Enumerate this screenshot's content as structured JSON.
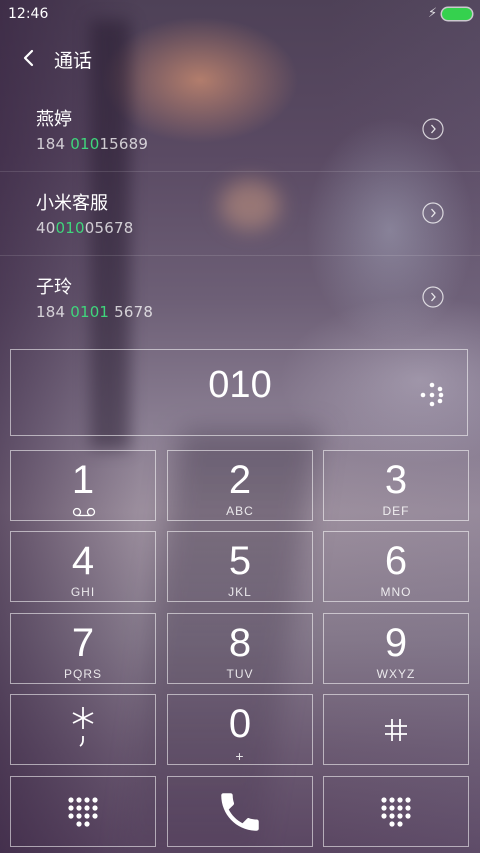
{
  "status": {
    "time": "12:46",
    "charging_icon": "bolt-icon",
    "battery_color": "#35d14e"
  },
  "header": {
    "title": "通话",
    "back_icon": "chevron-left-icon"
  },
  "contacts": [
    {
      "name": "燕婷",
      "number_pre": "184 ",
      "number_match": "010",
      "number_post": "15689"
    },
    {
      "name": "小米客服",
      "number_pre": "40",
      "number_match": "010",
      "number_post": "05678"
    },
    {
      "name": "子玲",
      "number_pre": "184 ",
      "number_match": "0101",
      "number_post": " 5678"
    }
  ],
  "highlight_color": "#3fd67c",
  "display": {
    "number": "010"
  },
  "keys": [
    {
      "digit": "1",
      "letters": ""
    },
    {
      "digit": "2",
      "letters": "ABC"
    },
    {
      "digit": "3",
      "letters": "DEF"
    },
    {
      "digit": "4",
      "letters": "GHI"
    },
    {
      "digit": "5",
      "letters": "JKL"
    },
    {
      "digit": "6",
      "letters": "MNO"
    },
    {
      "digit": "7",
      "letters": "PQRS"
    },
    {
      "digit": "8",
      "letters": "TUV"
    },
    {
      "digit": "9",
      "letters": "WXYZ"
    },
    {
      "digit": "",
      "letters": ""
    },
    {
      "digit": "0",
      "letters": "+"
    },
    {
      "digit": "",
      "letters": ""
    }
  ],
  "icons": {
    "voicemail": "voicemail-icon",
    "star": "asterisk-icon",
    "hash": "hash-icon",
    "dialpad_left": "dialpad-icon",
    "call": "phone-icon",
    "dialpad_right": "dialpad-icon"
  }
}
